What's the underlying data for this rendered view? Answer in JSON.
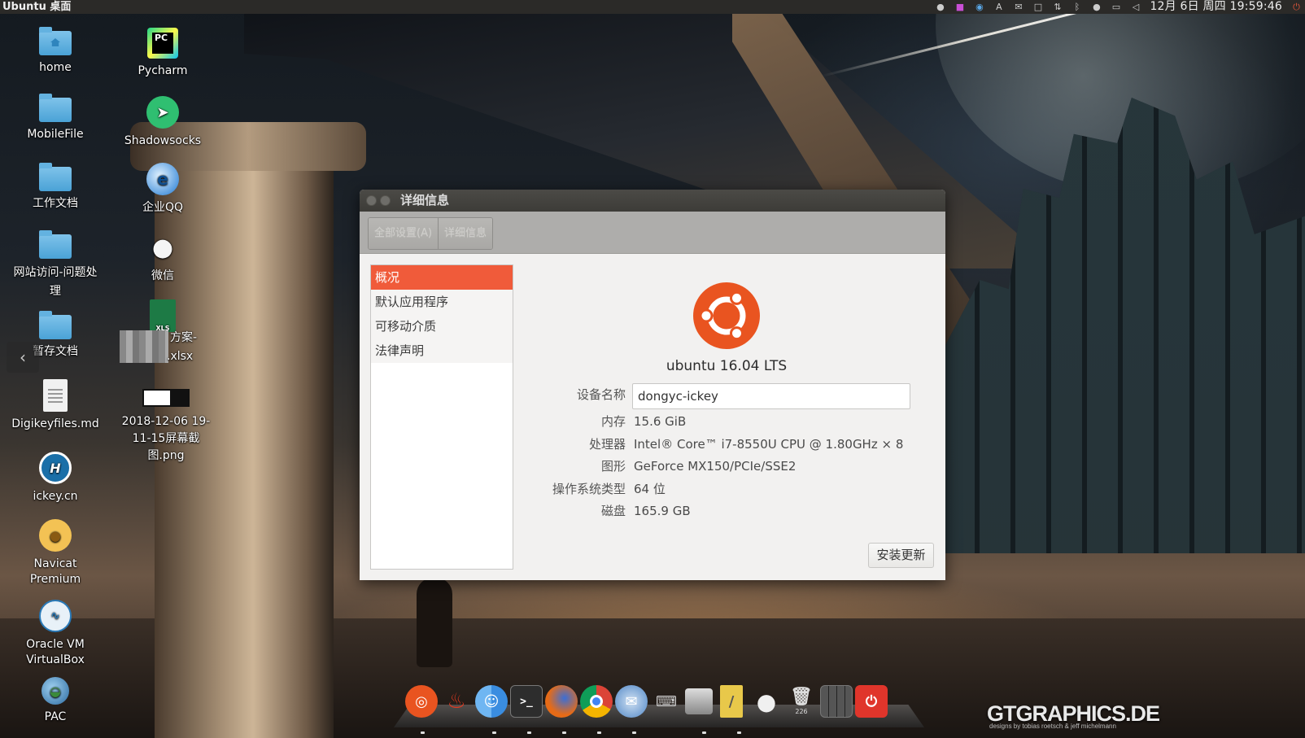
{
  "top_panel": {
    "title": "Ubuntu 桌面",
    "clock": "12月 6日 周四 19:59:46",
    "tray_icons": [
      "network-cloud-icon",
      "app-indicator-icon",
      "sync-icon",
      "input-method-icon",
      "wechat-tray-icon",
      "window-icon",
      "transfer-icon",
      "bluetooth-icon",
      "chat-icon",
      "battery-icon",
      "volume-icon"
    ]
  },
  "desktop": {
    "col1": [
      {
        "label": "home",
        "icon": "home-folder-icon"
      },
      {
        "label": "MobileFile",
        "icon": "folder-icon"
      },
      {
        "label": "工作文档",
        "icon": "folder-icon"
      },
      {
        "label": "网站访问-问题处理",
        "icon": "folder-icon"
      },
      {
        "label": "暂存文档",
        "icon": "folder-icon"
      },
      {
        "label": "Digikeyfiles.md",
        "icon": "document-icon"
      },
      {
        "label": "ickey.cn",
        "icon": "ickey-icon"
      },
      {
        "label": "Navicat Premium",
        "icon": "navicat-icon"
      },
      {
        "label": "Oracle VM VirtualBox",
        "icon": "virtualbox-icon"
      },
      {
        "label": "PAC",
        "icon": "pac-globe-icon"
      }
    ],
    "col2": [
      {
        "label": "Pycharm",
        "icon": "pycharm-icon"
      },
      {
        "label": "Shadowsocks",
        "icon": "shadowsocks-icon"
      },
      {
        "label": "企业QQ",
        "icon": "enterprise-qq-icon"
      },
      {
        "label": "微信",
        "icon": "wechat-icon"
      },
      {
        "label_line1": "方案-",
        "label_line2": ".xlsx",
        "icon": "xlsx-file-icon",
        "badge": "XLS"
      },
      {
        "label": "2018-12-06 19-11-15屏幕截图.png",
        "icon": "png-thumbnail-icon"
      }
    ]
  },
  "dialog": {
    "title": "详细信息",
    "toolbar": {
      "all_settings": "全部设置(A)",
      "details": "详细信息"
    },
    "sidebar": [
      {
        "label": "概况",
        "active": true
      },
      {
        "label": "默认应用程序",
        "active": false
      },
      {
        "label": "可移动介质",
        "active": false
      },
      {
        "label": "法律声明",
        "active": false
      }
    ],
    "os_name": "ubuntu 16.04 LTS",
    "info": {
      "device_name_label": "设备名称",
      "device_name_value": "dongyc-ickey",
      "memory_label": "内存",
      "memory_value": "15.6 GiB",
      "processor_label": "处理器",
      "processor_value": "Intel® Core™ i7-8550U CPU @ 1.80GHz × 8",
      "graphics_label": "图形",
      "graphics_value": "GeForce MX150/PCIe/SSE2",
      "os_type_label": "操作系统类型",
      "os_type_value": "64 位",
      "disk_label": "磁盘",
      "disk_value": "165.9 GB"
    },
    "install_updates": "安装更新"
  },
  "dock": {
    "items": [
      "ubuntu-logo-icon",
      "flame-app-icon",
      "finder-icon",
      "terminal-icon",
      "firefox-icon",
      "chrome-icon",
      "thunderbird-icon",
      "network-icon",
      "scanner-icon",
      "text-editor-icon",
      "wechat-icon",
      "trash-icon",
      "workspace-icon",
      "power-icon"
    ],
    "trash_count": "226"
  },
  "watermark": {
    "text": "GTGRAPHICS.DE",
    "sub": "designs by tobias roetsch & jeff michelmann"
  },
  "colors": {
    "ubuntu_orange": "#e95420",
    "active_sidebar": "#f05b3a",
    "panel": "#2b2a28"
  }
}
